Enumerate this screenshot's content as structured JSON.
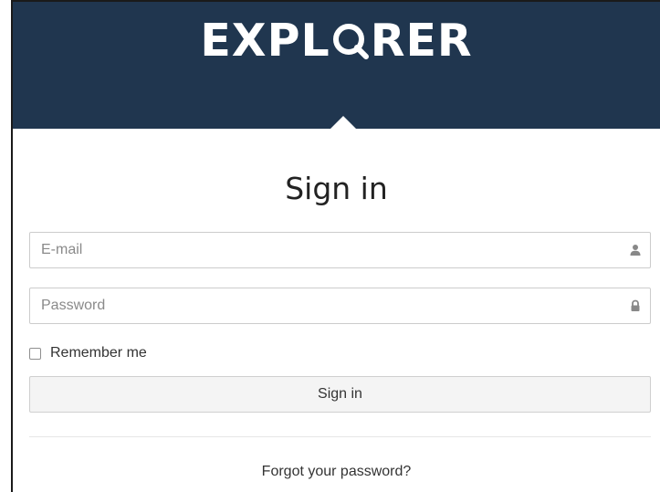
{
  "brand": {
    "logo_before_o": "EXPL",
    "logo_after_o": "RER",
    "logo_full": "EXPLORER",
    "header_color": "#20364f"
  },
  "form": {
    "title": "Sign in",
    "email": {
      "placeholder": "E-mail",
      "value": "",
      "icon": "user-icon"
    },
    "password": {
      "placeholder": "Password",
      "value": "",
      "icon": "lock-icon"
    },
    "remember_label": "Remember me",
    "remember_checked": false,
    "submit_label": "Sign in",
    "forgot_label": "Forgot your password?"
  }
}
